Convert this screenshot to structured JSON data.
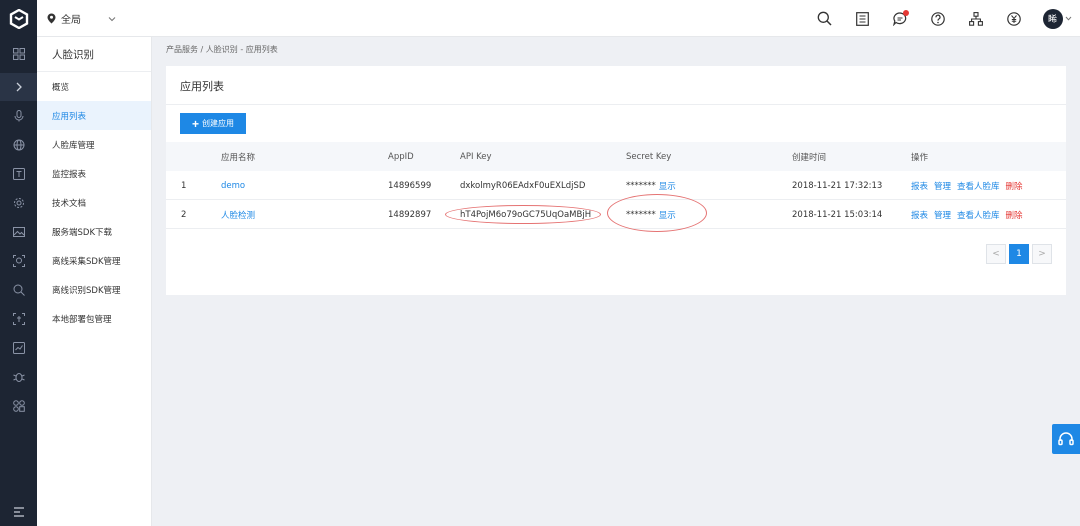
{
  "topbar": {
    "region_label": "全局",
    "avatar_text": "睎"
  },
  "submenu": {
    "title": "人脸识别",
    "items": [
      {
        "label": "概览"
      },
      {
        "label": "应用列表"
      },
      {
        "label": "人脸库管理"
      },
      {
        "label": "监控报表"
      },
      {
        "label": "技术文档"
      },
      {
        "label": "服务端SDK下载"
      },
      {
        "label": "离线采集SDK管理"
      },
      {
        "label": "离线识别SDK管理"
      },
      {
        "label": "本地部署包管理"
      }
    ]
  },
  "breadcrumb": "产品服务 / 人脸识别 - 应用列表",
  "card": {
    "title": "应用列表",
    "create_label": "创建应用"
  },
  "table": {
    "headers": {
      "name": "应用名称",
      "appid": "AppID",
      "apikey": "API Key",
      "secret": "Secret Key",
      "created": "创建时间",
      "ops": "操作"
    },
    "rows": [
      {
        "index": "1",
        "name": "demo",
        "appid": "14896599",
        "apikey": "dxkolmyR06EAdxF0uEXLdjSD",
        "secret_mask": "*******",
        "show": "显示",
        "created": "2018-11-21 17:32:13",
        "op_report": "报表",
        "op_manage": "管理",
        "op_facedb": "查看人脸库",
        "op_delete": "删除"
      },
      {
        "index": "2",
        "name": "人脸检测",
        "appid": "14892897",
        "apikey": "hT4PojM6o79oGC75UqOaMBjH",
        "secret_mask": "*******",
        "show": "显示",
        "created": "2018-11-21 15:03:14",
        "op_report": "报表",
        "op_manage": "管理",
        "op_facedb": "查看人脸库",
        "op_delete": "删除"
      }
    ]
  },
  "pager": {
    "prev": "<",
    "current": "1",
    "next": ">"
  },
  "colors": {
    "accent": "#1e88e5",
    "danger": "#e53935",
    "rail": "#1d2533"
  }
}
